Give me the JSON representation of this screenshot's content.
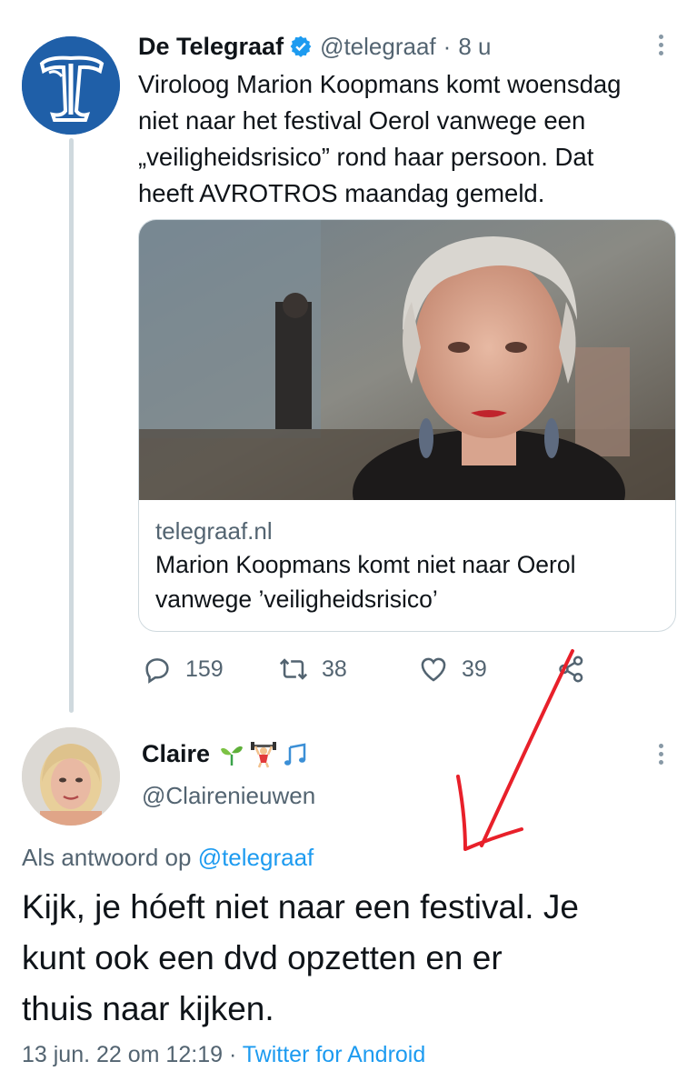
{
  "tweet1": {
    "name": "De Telegraaf",
    "handle": "@telegraaf",
    "dot": "·",
    "time": "8 u",
    "text_lines": [
      "Viroloog Marion Koopmans komt woensdag",
      "niet naar het festival Oerol vanwege een",
      "„veiligheidsrisico” rond haar persoon. Dat",
      "heeft AVROTROS maandag gemeld."
    ],
    "card": {
      "domain": "telegraaf.nl",
      "title_lines": [
        "Marion Koopmans komt niet naar Oerol",
        "vanwege ’veiligheidsrisico’"
      ]
    },
    "actions": {
      "replies": "159",
      "retweets": "38",
      "likes": "39"
    },
    "icons": [
      "verified-badge-icon",
      "more-options-icon",
      "reply-icon",
      "retweet-icon",
      "like-icon",
      "share-icon"
    ]
  },
  "tweet2": {
    "name": "Claire",
    "handle": "@Clairenieuwen",
    "reply_prefix": "Als antwoord op",
    "reply_handle": "@telegraaf",
    "text_lines": [
      "Kijk, je hóeft niet naar een festival. Je",
      "kunt ook een dvd opzetten en er",
      "thuis naar kijken."
    ],
    "timestamp": "13 jun. 22 om 12:19",
    "dot": "·",
    "source": "Twitter for Android",
    "name_emojis": [
      "seedling-emoji",
      "weightlifter-emoji",
      "music-notes-emoji"
    ]
  },
  "colors": {
    "link": "#1d9bf0",
    "secondary": "#536471",
    "annotation": "#e8202a",
    "brand_blue": "#1f5fa8"
  }
}
